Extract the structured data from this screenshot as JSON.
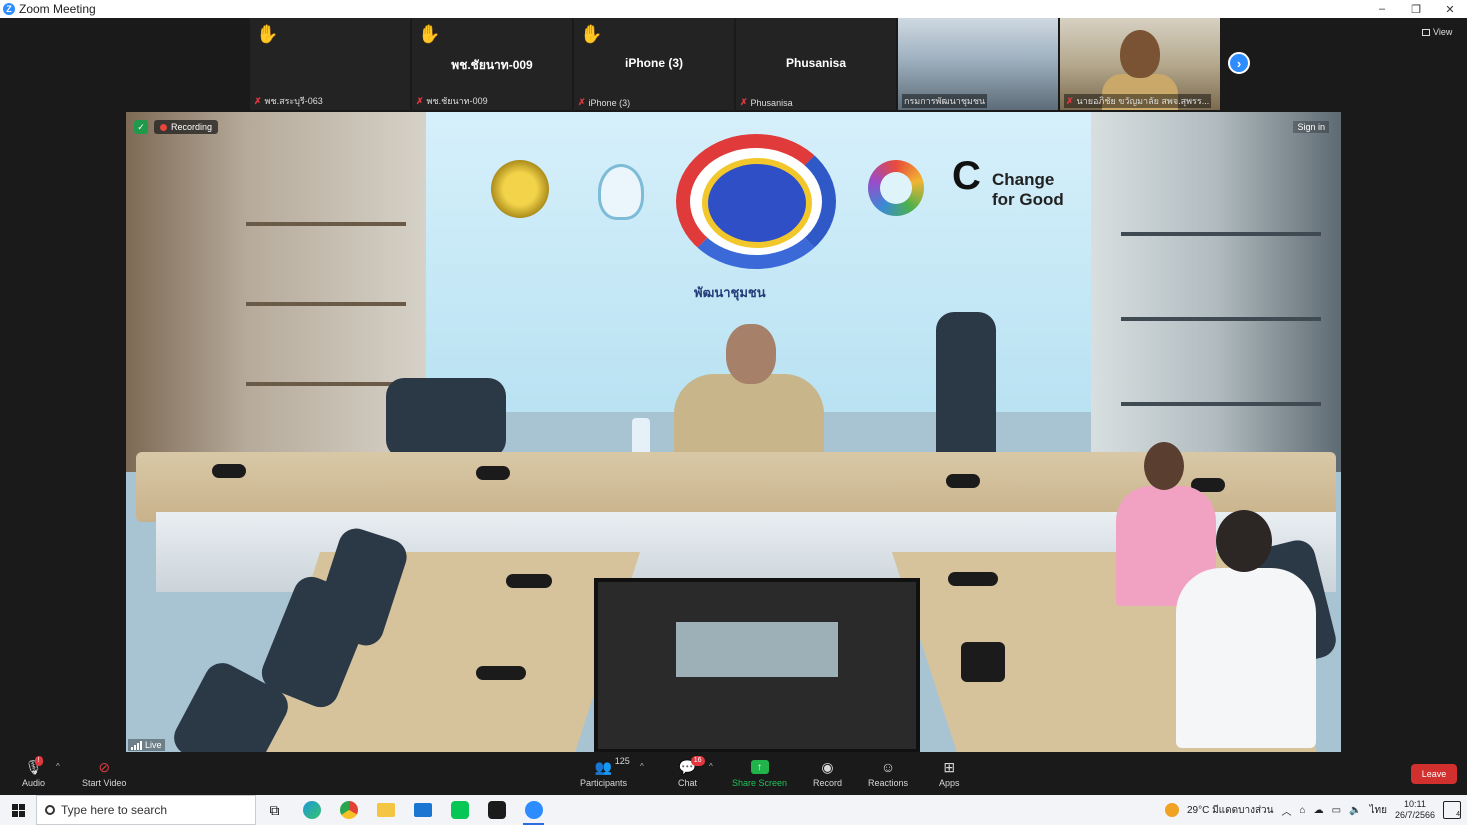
{
  "window": {
    "title": "Zoom Meeting",
    "controls": [
      "–",
      "❐",
      "✕"
    ]
  },
  "gallery": {
    "tiles": [
      {
        "center": "",
        "name": "พช.สระบุรี-063",
        "hand": true
      },
      {
        "center": "พช.ชัยนาท-009",
        "name": "พช.ชัยนาท-009",
        "hand": true
      },
      {
        "center": "iPhone (3)",
        "name": "iPhone (3)",
        "hand": true
      },
      {
        "center": "Phusanisa",
        "name": "Phusanisa",
        "hand": false
      },
      {
        "center": "",
        "name": "กรมการพัฒนาชุมชน",
        "hand": false
      },
      {
        "center": "",
        "name": "นายอภิชัย ขวัญมาลัย สพจ.สุพรร...",
        "hand": false
      }
    ],
    "view_label": "View"
  },
  "main_video": {
    "recording_label": "Recording",
    "signin_label": "Sign in",
    "live_label": "Live",
    "backdrop_text": "Change for Good",
    "backdrop_sub": "พัฒนาชุมชน"
  },
  "toolbar": {
    "audio": "Audio",
    "start_video": "Start Video",
    "participants": "Participants",
    "participants_count": "125",
    "chat": "Chat",
    "chat_badge": "16",
    "share_screen": "Share Screen",
    "record": "Record",
    "reactions": "Reactions",
    "apps": "Apps",
    "leave": "Leave"
  },
  "taskbar": {
    "search_placeholder": "Type here to search",
    "weather": "29°C มีแดดบางส่วน",
    "lang": "ไทย",
    "time": "10:11",
    "date": "26/7/2566",
    "notif_count": "4"
  },
  "colors": {
    "zoom_blue": "#2d8cff",
    "leave_red": "#d1302f",
    "share_green": "#21b44b"
  }
}
